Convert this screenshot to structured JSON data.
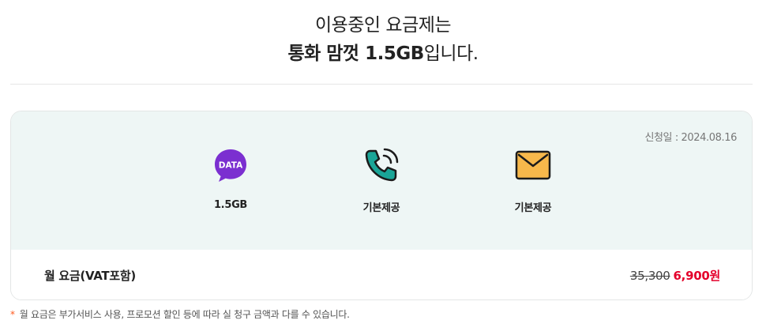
{
  "header": {
    "line1": "이용중인 요금제는",
    "plan_name": "통화 맘껏 1.5GB",
    "line2_suffix": "입니다."
  },
  "card": {
    "apply_date": "신청일 : 2024.08.16",
    "benefits": [
      {
        "icon": "data-bubble-icon",
        "icon_text": "DATA",
        "label": "1.5GB",
        "color": "#7b2fd0"
      },
      {
        "icon": "phone-call-icon",
        "label": "기본제공",
        "color": "#1aa597"
      },
      {
        "icon": "envelope-icon",
        "label": "기본제공",
        "color": "#f7b84b"
      }
    ],
    "fee": {
      "label": "월 요금(VAT포함)",
      "original": "35,300",
      "price": "6,900원"
    }
  },
  "footer_note": {
    "star": "*",
    "text": "월 요금은 부가서비스 사용, 프로모션 할인 등에 따라 실 청구 금액과 다를 수 있습니다."
  },
  "colors": {
    "accent_price": "#e4002b",
    "panel_bg": "#eef6f5",
    "note_star": "#ff5a1f"
  }
}
